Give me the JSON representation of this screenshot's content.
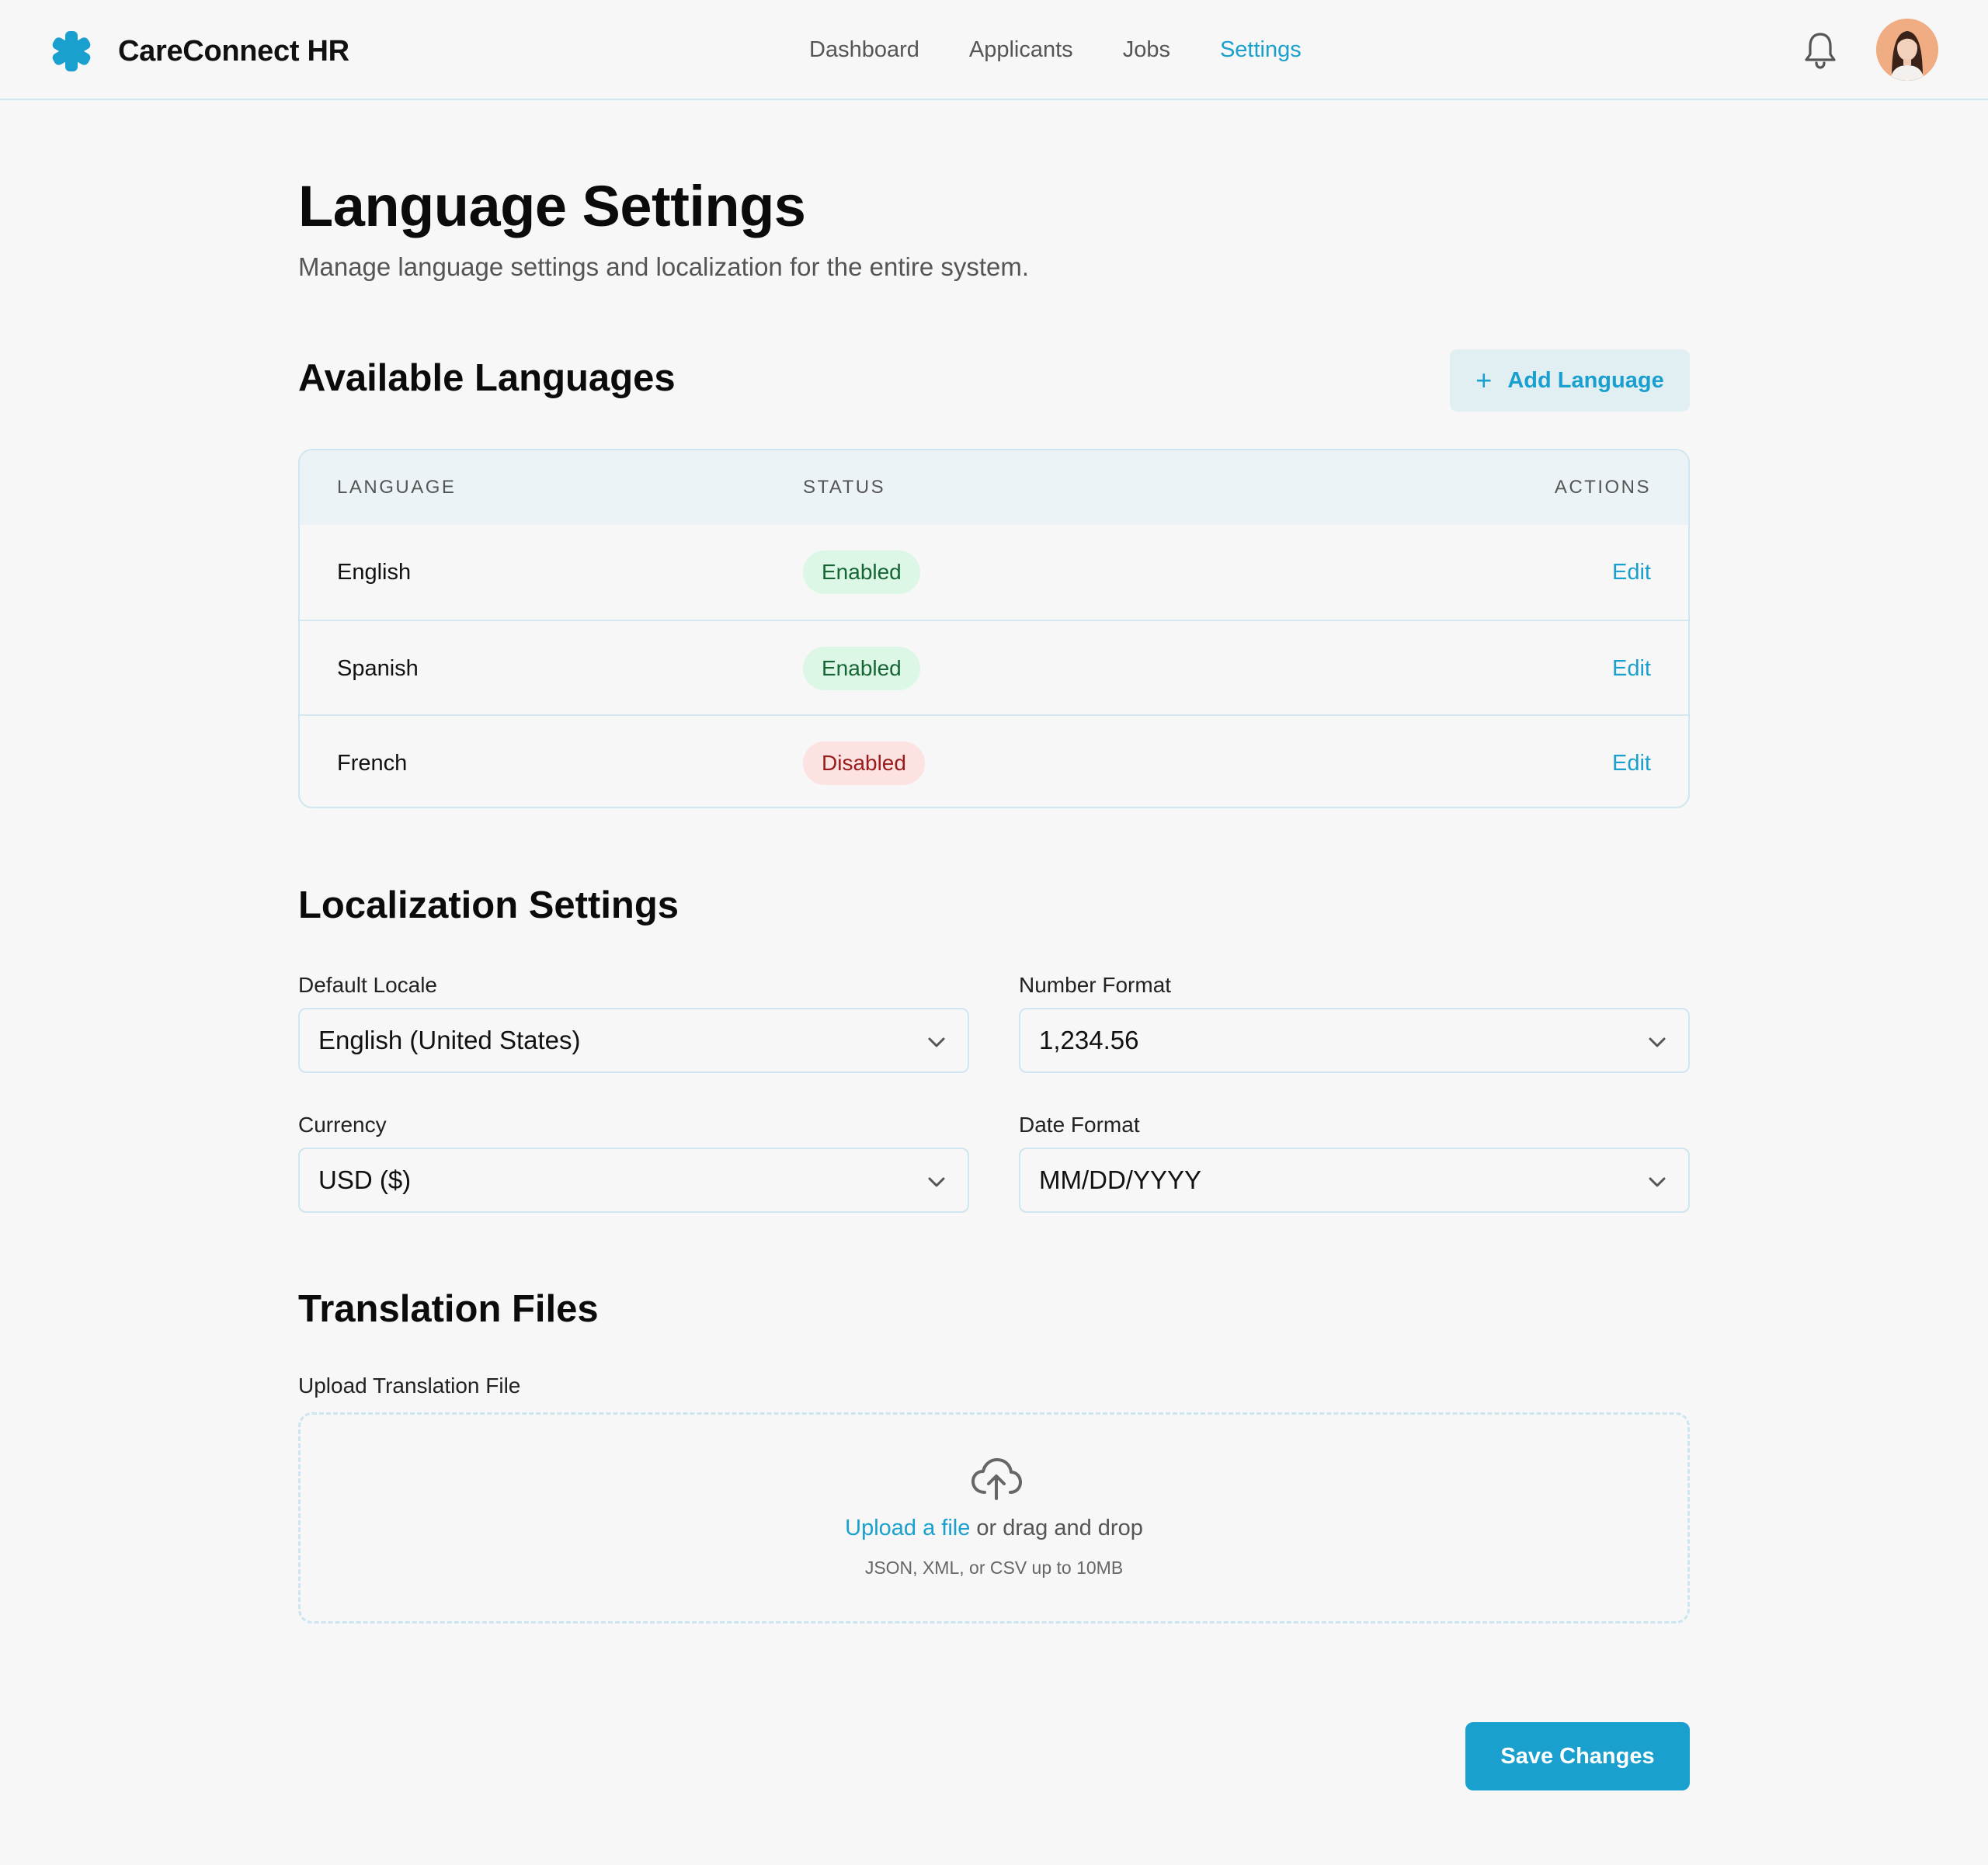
{
  "app": {
    "name": "CareConnect HR",
    "brand_color": "#1aa0cf"
  },
  "nav": {
    "items": [
      {
        "label": "Dashboard",
        "active": false
      },
      {
        "label": "Applicants",
        "active": false
      },
      {
        "label": "Jobs",
        "active": false
      },
      {
        "label": "Settings",
        "active": true
      }
    ]
  },
  "header_icons": {
    "notifications": "bell-icon",
    "avatar": "user-avatar"
  },
  "page": {
    "title": "Language Settings",
    "subtitle": "Manage language settings and localization for the entire system."
  },
  "languages_section": {
    "title": "Available Languages",
    "add_button": "Add Language",
    "columns": {
      "language": "LANGUAGE",
      "status": "STATUS",
      "actions": "ACTIONS"
    },
    "rows": [
      {
        "language": "English",
        "status": "Enabled",
        "action": "Edit"
      },
      {
        "language": "Spanish",
        "status": "Enabled",
        "action": "Edit"
      },
      {
        "language": "French",
        "status": "Disabled",
        "action": "Edit"
      }
    ]
  },
  "localization_section": {
    "title": "Localization Settings",
    "default_locale": {
      "label": "Default Locale",
      "value": "English (United States)"
    },
    "number_format": {
      "label": "Number Format",
      "value": "1,234.56"
    },
    "currency": {
      "label": "Currency",
      "value": "USD ($)"
    },
    "date_format": {
      "label": "Date Format",
      "value": "MM/DD/YYYY"
    }
  },
  "translation_section": {
    "title": "Translation Files",
    "upload_label": "Upload Translation File",
    "upload_link": "Upload a file",
    "upload_text": "or drag and drop",
    "upload_hint": "JSON, XML, or CSV up to 10MB"
  },
  "save_button": "Save Changes",
  "status_colors": {
    "enabled_bg": "#dcf7e5",
    "enabled_text": "#166534",
    "disabled_bg": "#fde2e2",
    "disabled_text": "#991b1b"
  }
}
